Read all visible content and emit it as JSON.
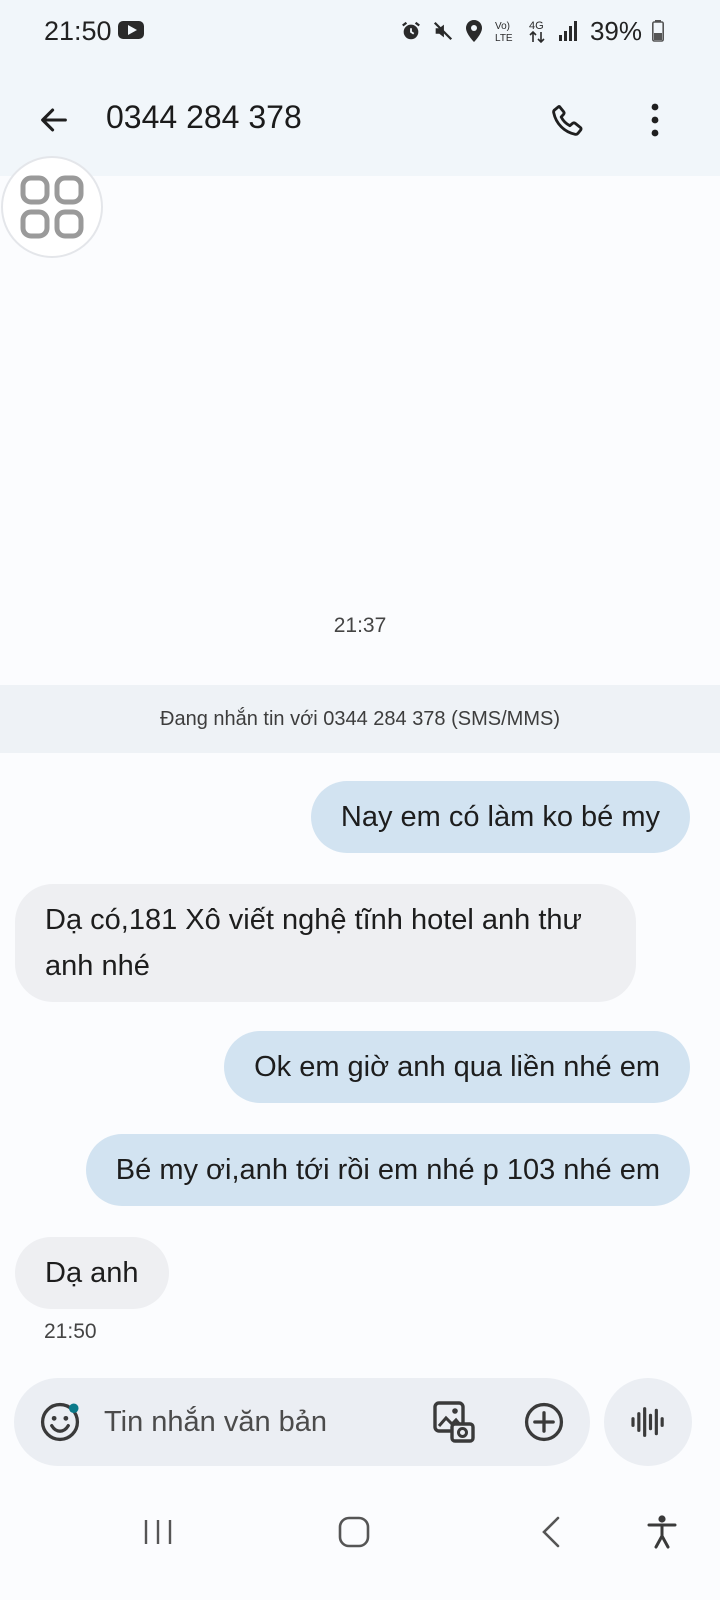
{
  "status_bar": {
    "time": "21:50",
    "battery": "39%",
    "network": "4G",
    "icons": [
      "youtube-icon",
      "alarm-icon",
      "mute-icon",
      "location-icon",
      "volte-icon",
      "network-4g-icon",
      "signal-icon",
      "battery-icon"
    ]
  },
  "header": {
    "title": "0344 284 378",
    "icons": [
      "back-arrow-icon",
      "phone-icon",
      "more-vert-icon"
    ]
  },
  "conversation": {
    "time_header": "21:37",
    "banner": "Đang nhắn tin với 0344 284 378 (SMS/MMS)",
    "messages": [
      {
        "direction": "outgoing",
        "text": "Nay em có làm ko bé my"
      },
      {
        "direction": "incoming",
        "text_line1": "Dạ có,181 Xô viết nghệ tĩnh hotel anh thư",
        "text_line2": "anh nhé"
      },
      {
        "direction": "outgoing",
        "text": "Ok em giờ anh qua liền nhé em"
      },
      {
        "direction": "outgoing",
        "text": "Bé my ơi,anh tới rồi em nhé p 103 nhé em"
      },
      {
        "direction": "incoming",
        "text": "Dạ anh"
      }
    ],
    "last_time": "21:50"
  },
  "composer": {
    "placeholder": "Tin nhắn văn bản",
    "value": ""
  },
  "colors": {
    "outgoing_bubble": "#d2e3f1",
    "incoming_bubble": "#eeeff2",
    "header_bg": "#f1f6fa",
    "banner_bg": "#eef2f6"
  }
}
